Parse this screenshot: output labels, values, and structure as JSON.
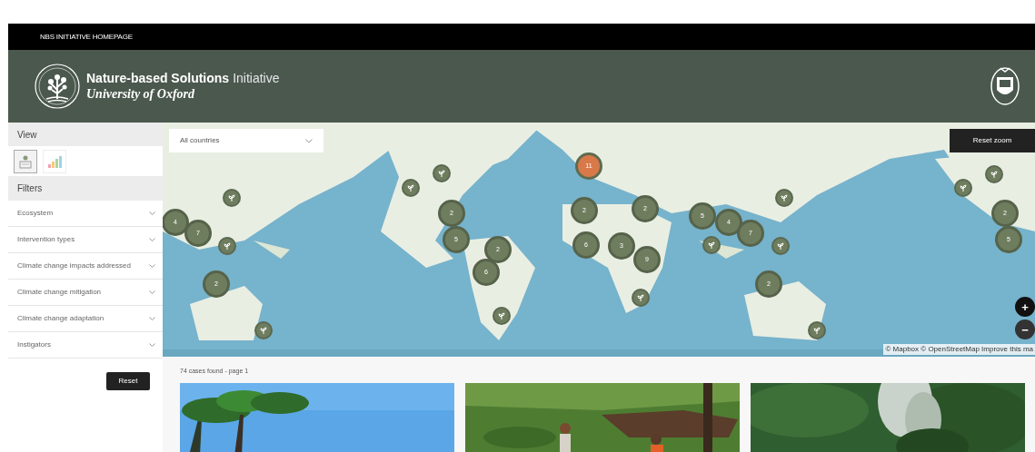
{
  "top_bar": {
    "link": "NBS INITIATIVE HOMEPAGE"
  },
  "header": {
    "title_bold": "Nature-based Solutions",
    "title_rest": "Initiative",
    "subtitle": "University of Oxford"
  },
  "sidebar": {
    "view_heading": "View",
    "view_options": [
      {
        "kind": "map",
        "selected": true
      },
      {
        "kind": "chart",
        "selected": false
      }
    ],
    "filters_heading": "Filters",
    "filters": [
      {
        "label": "Ecosystem",
        "expanded": false
      },
      {
        "label": "Intervention types",
        "expanded": false
      },
      {
        "label": "Climate change impacts addressed",
        "expanded": false
      },
      {
        "label": "Climate change mitigation",
        "expanded": false
      },
      {
        "label": "Climate change adaptation",
        "expanded": false
      },
      {
        "label": "Instigators",
        "expanded": false
      }
    ],
    "reset_button": "Reset"
  },
  "map": {
    "country_select": {
      "value": "All countries"
    },
    "reset_zoom_button": "Reset zoom",
    "zoom_in": "+",
    "zoom_out": "−",
    "attribution": "© Mapbox © OpenStreetMap Improve this ma",
    "markers": [
      {
        "kind": "cluster",
        "count": "4",
        "highlighted": false
      },
      {
        "kind": "cluster",
        "count": "7",
        "highlighted": false
      },
      {
        "kind": "single"
      },
      {
        "kind": "single"
      },
      {
        "kind": "cluster",
        "count": "2",
        "highlighted": false
      },
      {
        "kind": "single"
      },
      {
        "kind": "single"
      },
      {
        "kind": "single"
      },
      {
        "kind": "cluster",
        "count": "2",
        "highlighted": false
      },
      {
        "kind": "cluster",
        "count": "5",
        "highlighted": false
      },
      {
        "kind": "cluster",
        "count": "2",
        "highlighted": false
      },
      {
        "kind": "cluster",
        "count": "6",
        "highlighted": false
      },
      {
        "kind": "single"
      },
      {
        "kind": "cluster",
        "count": "11",
        "highlighted": true
      },
      {
        "kind": "cluster",
        "count": "2",
        "highlighted": false
      },
      {
        "kind": "cluster",
        "count": "6",
        "highlighted": false
      },
      {
        "kind": "cluster",
        "count": "2",
        "highlighted": false
      },
      {
        "kind": "cluster",
        "count": "3",
        "highlighted": false
      },
      {
        "kind": "cluster",
        "count": "9",
        "highlighted": false
      },
      {
        "kind": "single"
      },
      {
        "kind": "cluster",
        "count": "5",
        "highlighted": false
      },
      {
        "kind": "cluster",
        "count": "4",
        "highlighted": false
      },
      {
        "kind": "cluster",
        "count": "7",
        "highlighted": false
      },
      {
        "kind": "single"
      },
      {
        "kind": "single"
      },
      {
        "kind": "single"
      },
      {
        "kind": "cluster",
        "count": "2",
        "highlighted": false
      },
      {
        "kind": "single"
      },
      {
        "kind": "single"
      },
      {
        "kind": "single"
      },
      {
        "kind": "cluster",
        "count": "2",
        "highlighted": false
      },
      {
        "kind": "cluster",
        "count": "5",
        "highlighted": false
      }
    ]
  },
  "results": {
    "summary": "74 cases found - page 1"
  }
}
